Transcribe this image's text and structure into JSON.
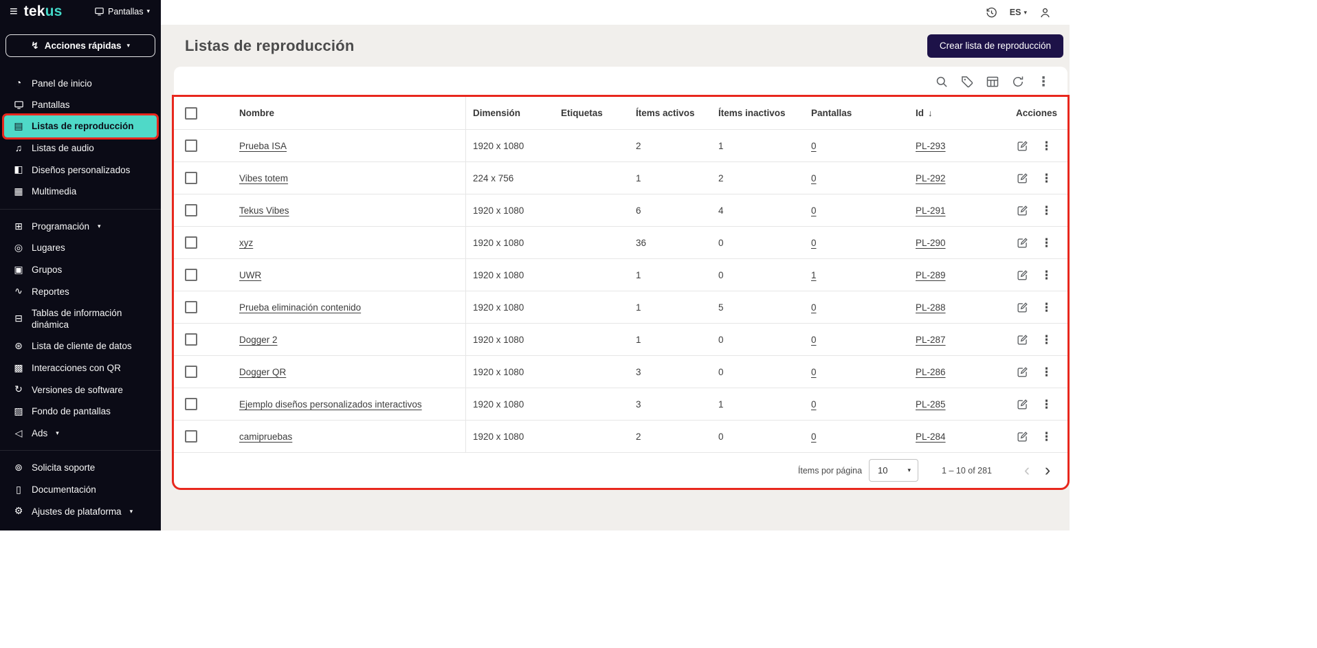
{
  "colors": {
    "sidebar_bg": "#0b0b16",
    "accent_teal": "#43d8c8",
    "selected_item_bg": "#4fd9c8",
    "content_bg": "#f1efec",
    "primary_button_bg": "#1d1248",
    "annotation_red": "#e8271d"
  },
  "topbar": {
    "language": "ES",
    "icons": [
      "history-icon",
      "user-icon"
    ]
  },
  "sidebar": {
    "logo_tek": "tek",
    "logo_us": "us",
    "screens_dropdown_label": "Pantallas",
    "quick_actions_label": "Acciones rápidas",
    "items": [
      {
        "label": "Panel de inicio",
        "icon": "dashboard-icon"
      },
      {
        "label": "Pantallas",
        "icon": "monitor-icon"
      },
      {
        "label": "Listas de reproducción",
        "icon": "playlist-icon",
        "selected": true,
        "annotated": true
      },
      {
        "label": "Listas de audio",
        "icon": "audio-lists-icon"
      },
      {
        "label": "Diseños personalizados",
        "icon": "custom-designs-icon"
      },
      {
        "label": "Multimedia",
        "icon": "multimedia-icon",
        "divider_after": true
      },
      {
        "label": "Programación",
        "icon": "schedule-icon",
        "caret": true
      },
      {
        "label": "Lugares",
        "icon": "places-icon"
      },
      {
        "label": "Grupos",
        "icon": "groups-icon"
      },
      {
        "label": "Reportes",
        "icon": "reports-icon"
      },
      {
        "label": "Tablas de información dinámica",
        "icon": "dynamic-info-tables-icon"
      },
      {
        "label": "Lista de cliente de datos",
        "icon": "data-client-list-icon"
      },
      {
        "label": "Interacciones con QR",
        "icon": "qr-interactions-icon"
      },
      {
        "label": "Versiones de software",
        "icon": "software-versions-icon"
      },
      {
        "label": "Fondo de pantallas",
        "icon": "screens-background-icon"
      },
      {
        "label": "Ads",
        "icon": "ads-icon",
        "caret": true,
        "divider_after": true
      }
    ],
    "bottom_items": [
      {
        "label": "Solicita soporte",
        "icon": "support-icon"
      },
      {
        "label": "Documentación",
        "icon": "documentation-icon"
      },
      {
        "label": "Ajustes de plataforma",
        "icon": "platform-settings-icon",
        "caret": true
      }
    ]
  },
  "header": {
    "title": "Listas de reproducción",
    "create_button_label": "Crear lista de reproducción"
  },
  "toolbar": {
    "icons": [
      "search-icon",
      "tag-icon",
      "table-view-icon",
      "refresh-icon",
      "more-options-icon"
    ]
  },
  "table": {
    "columns": [
      "",
      "Nombre",
      "Dimensión",
      "Etiquetas",
      "Ítems activos",
      "Ítems inactivos",
      "Pantallas",
      "Id",
      "Acciones"
    ],
    "sorted_column": "Id",
    "sort_direction": "desc",
    "row_actions": [
      "edit-icon",
      "row-more-icon"
    ],
    "rows": [
      {
        "name": "Prueba ISA",
        "dimension": "1920 x 1080",
        "tags": "",
        "active_items": "2",
        "inactive_items": "1",
        "screens": "0",
        "id": "PL-293"
      },
      {
        "name": "Vibes totem",
        "dimension": "224 x 756",
        "tags": "",
        "active_items": "1",
        "inactive_items": "2",
        "screens": "0",
        "id": "PL-292"
      },
      {
        "name": "Tekus Vibes",
        "dimension": "1920 x 1080",
        "tags": "",
        "active_items": "6",
        "inactive_items": "4",
        "screens": "0",
        "id": "PL-291"
      },
      {
        "name": "xyz",
        "dimension": "1920 x 1080",
        "tags": "",
        "active_items": "36",
        "inactive_items": "0",
        "screens": "0",
        "id": "PL-290"
      },
      {
        "name": "UWR",
        "dimension": "1920 x 1080",
        "tags": "",
        "active_items": "1",
        "inactive_items": "0",
        "screens": "1",
        "id": "PL-289"
      },
      {
        "name": "Prueba eliminación contenido",
        "dimension": "1920 x 1080",
        "tags": "",
        "active_items": "1",
        "inactive_items": "5",
        "screens": "0",
        "id": "PL-288"
      },
      {
        "name": "Dogger 2",
        "dimension": "1920 x 1080",
        "tags": "",
        "active_items": "1",
        "inactive_items": "0",
        "screens": "0",
        "id": "PL-287"
      },
      {
        "name": "Dogger QR",
        "dimension": "1920 x 1080",
        "tags": "",
        "active_items": "3",
        "inactive_items": "0",
        "screens": "0",
        "id": "PL-286"
      },
      {
        "name": "Ejemplo diseños personalizados interactivos",
        "dimension": "1920 x 1080",
        "tags": "",
        "active_items": "3",
        "inactive_items": "1",
        "screens": "0",
        "id": "PL-285"
      },
      {
        "name": "camipruebas",
        "dimension": "1920 x 1080",
        "tags": "",
        "active_items": "2",
        "inactive_items": "0",
        "screens": "0",
        "id": "PL-284"
      }
    ],
    "footer": {
      "items_per_page_label": "Ítems por página",
      "items_per_page_value": "10",
      "range": "1 – 10 of 281"
    }
  },
  "annotations": {
    "highlight_color": "#e8271d",
    "highlighted": [
      "sidebar-item-listas-de-reproduccion",
      "playlists-table"
    ]
  }
}
